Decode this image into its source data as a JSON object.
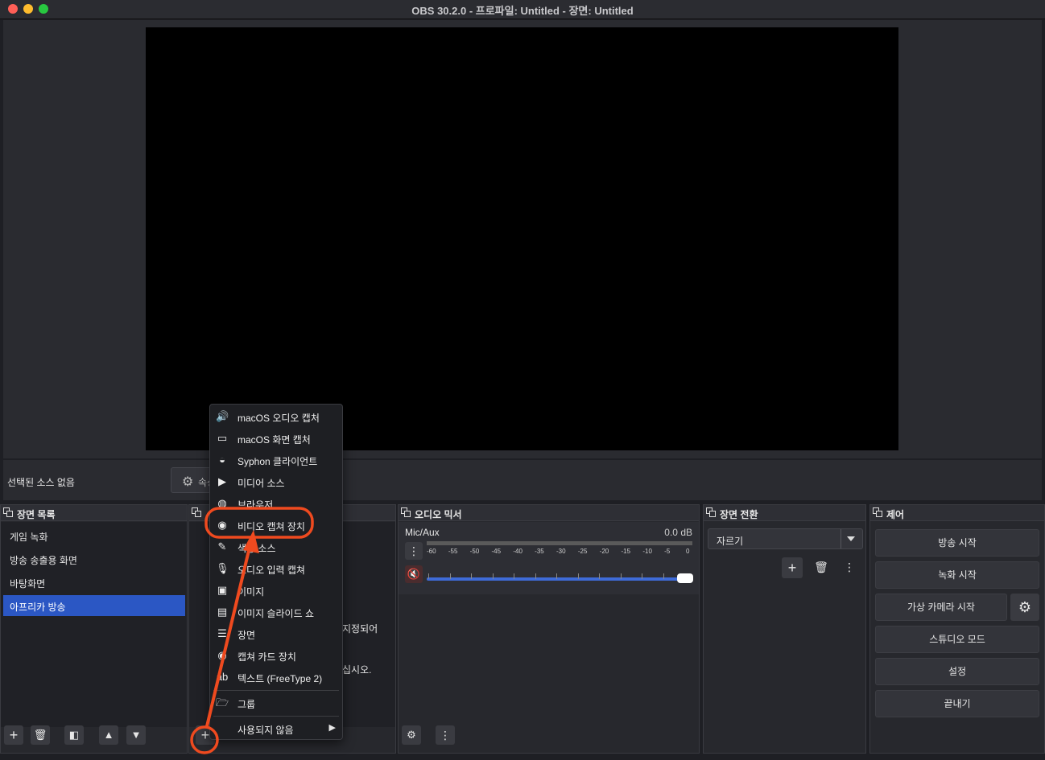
{
  "window": {
    "title": "OBS 30.2.0 - 프로파일: Untitled - 장면: Untitled"
  },
  "source_bar": {
    "no_source": "선택된 소스 없음",
    "properties_partial": "속성"
  },
  "scenes": {
    "title": "장면 목록",
    "items": [
      {
        "label": "게임 녹화"
      },
      {
        "label": "방송 송출용 화면"
      },
      {
        "label": "바탕화면"
      },
      {
        "label": "아프리카 방송",
        "selected": true
      }
    ]
  },
  "sources": {
    "behind_text_1": "지정되어",
    "behind_text_2": "십시오."
  },
  "mixer": {
    "title": "오디오 믹서",
    "channel": "Mic/Aux",
    "db": "0.0 dB",
    "ticks": [
      "-60",
      "-55",
      "-50",
      "-45",
      "-40",
      "-35",
      "-30",
      "-25",
      "-20",
      "-15",
      "-10",
      "-5",
      "0"
    ],
    "muted": true,
    "volume_fraction": 1.0
  },
  "transitions": {
    "title": "장면 전환",
    "selected": "자르기"
  },
  "controls": {
    "title": "제어",
    "buttons": [
      "방송 시작",
      "녹화 시작",
      "가상 카메라 시작",
      "스튜디오 모드",
      "설정",
      "끝내기"
    ]
  },
  "menu": {
    "items": [
      {
        "icon": "speaker-icon",
        "label": "macOS 오디오 캡처"
      },
      {
        "icon": "monitor-icon",
        "label": "macOS 화면 캡처"
      },
      {
        "icon": "syphon-icon",
        "label": "Syphon 클라이언트"
      },
      {
        "icon": "play-icon",
        "label": "미디어 소스"
      },
      {
        "icon": "globe-icon",
        "label": "브라우저"
      },
      {
        "icon": "camera-icon",
        "label": "비디오 캡쳐 장치",
        "highlighted": true
      },
      {
        "icon": "brush-icon",
        "label": "색상 소스"
      },
      {
        "icon": "microphone-icon",
        "label": "오디오 입력 캡쳐"
      },
      {
        "icon": "image-icon",
        "label": "이미지"
      },
      {
        "icon": "slideshow-icon",
        "label": "이미지 슬라이드 쇼"
      },
      {
        "icon": "list-icon",
        "label": "장면"
      },
      {
        "icon": "camera-icon",
        "label": "캡쳐 카드 장치"
      },
      {
        "icon": "text-icon",
        "label": "텍스트 (FreeType 2)"
      }
    ],
    "group": {
      "icon": "folder-icon",
      "label": "그룹"
    },
    "deprecated": {
      "label": "사용되지 않음"
    }
  },
  "annotation": {
    "color": "#ef4a1f"
  }
}
